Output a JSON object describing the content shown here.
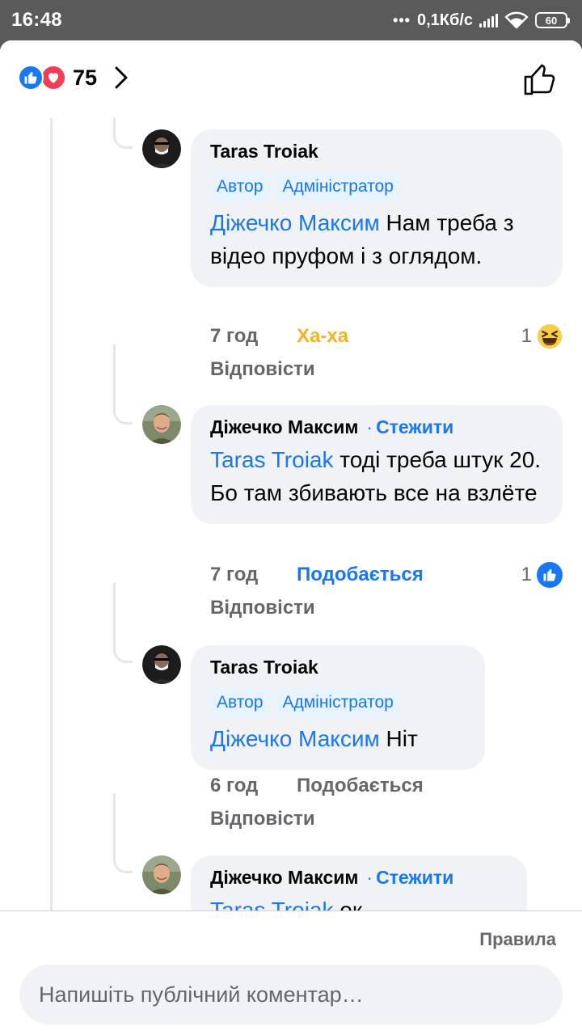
{
  "status_bar": {
    "time": "16:48",
    "dots": "•••",
    "speed": "0,1Кб/с",
    "battery": "60"
  },
  "header": {
    "reaction_count": "75"
  },
  "comments": [
    {
      "author": "Taras Troiak",
      "badges": [
        "Автор",
        "Адміністратор"
      ],
      "mention": "Діжечко Максим",
      "text": " Нам треба з відео пруфом і з оглядом.",
      "time": "7 год",
      "action": "Ха-ха",
      "reply": "Відповісти",
      "reaction_count": "1",
      "reaction_icon": "haha-icon"
    },
    {
      "author": "Діжечко Максим",
      "follow": "Стежити",
      "mention": "Taras Troiak",
      "text": " тоді треба штук 20. Бо там збивають все на взлёте",
      "time": "7 год",
      "action": "Подобається",
      "reply": "Відповісти",
      "reaction_count": "1",
      "reaction_icon": "like-icon"
    },
    {
      "author": "Taras Troiak",
      "badges": [
        "Автор",
        "Адміністратор"
      ],
      "mention": "Діжечко Максим",
      "text": " Ніт",
      "time": "6 год",
      "action": "Подобається",
      "reply": "Відповісти"
    },
    {
      "author": "Діжечко Максим",
      "follow": "Стежити",
      "mention": "Taras Troiak",
      "text": " ок"
    }
  ],
  "footer": {
    "rules": "Правила",
    "comment_placeholder": "Напишіть публічний коментар…"
  },
  "colors": {
    "accent": "#1877f2",
    "haha": "#f7b125",
    "love": "#f33e58",
    "bubble": "#f0f2f5",
    "secondary_text": "#65676b"
  }
}
